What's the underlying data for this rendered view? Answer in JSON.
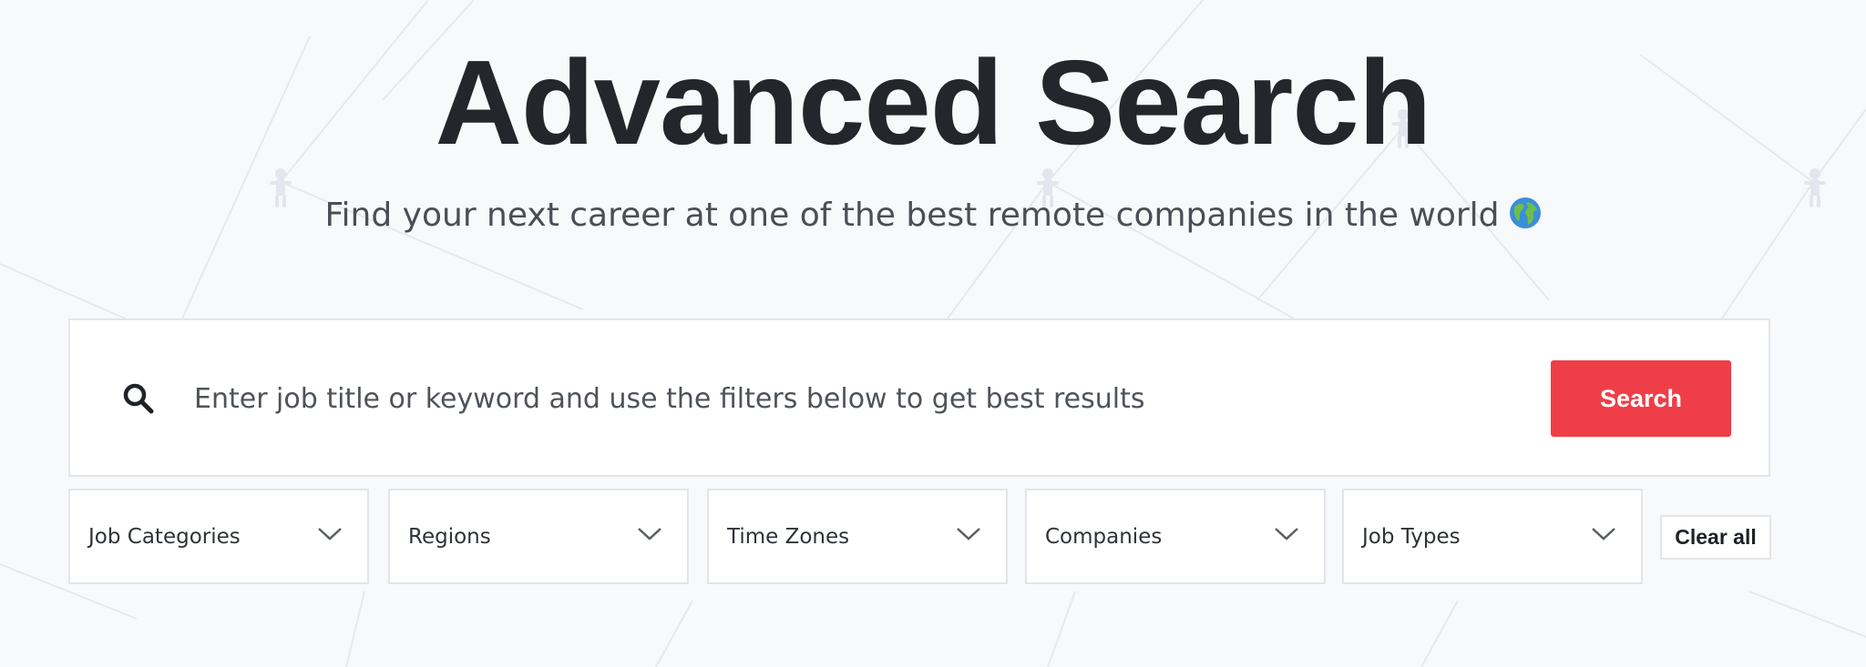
{
  "header": {
    "title": "Advanced Search",
    "subtitle": "Find your next career at one of the best remote companies in the world"
  },
  "subtitle_emoji_icon": "globe-icon",
  "search": {
    "placeholder": "Enter job title or keyword and use the filters below to get best results",
    "value": "",
    "button_label": "Search",
    "icon": "search-icon"
  },
  "filters": [
    {
      "label": "Job Categories",
      "icon": "chevron-down-icon"
    },
    {
      "label": "Regions",
      "icon": "chevron-down-icon"
    },
    {
      "label": "Time Zones",
      "icon": "chevron-down-icon"
    },
    {
      "label": "Companies",
      "icon": "chevron-down-icon"
    },
    {
      "label": "Job Types",
      "icon": "chevron-down-icon"
    }
  ],
  "clear_all_label": "Clear all",
  "colors": {
    "accent": "#ef3e48",
    "background": "#f8f9fb",
    "title_text": "#23272c",
    "border": "#e3e5ea"
  }
}
